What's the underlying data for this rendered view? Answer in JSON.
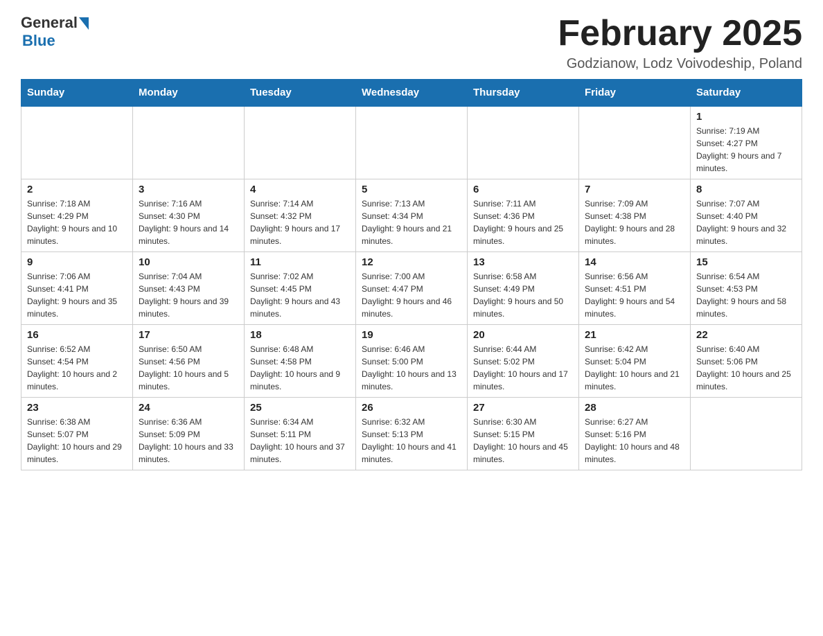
{
  "header": {
    "logo_general": "General",
    "logo_blue": "Blue",
    "month_title": "February 2025",
    "location": "Godzianow, Lodz Voivodeship, Poland"
  },
  "days_of_week": [
    "Sunday",
    "Monday",
    "Tuesday",
    "Wednesday",
    "Thursday",
    "Friday",
    "Saturday"
  ],
  "weeks": [
    {
      "days": [
        {
          "num": "",
          "info": ""
        },
        {
          "num": "",
          "info": ""
        },
        {
          "num": "",
          "info": ""
        },
        {
          "num": "",
          "info": ""
        },
        {
          "num": "",
          "info": ""
        },
        {
          "num": "",
          "info": ""
        },
        {
          "num": "1",
          "info": "Sunrise: 7:19 AM\nSunset: 4:27 PM\nDaylight: 9 hours and 7 minutes."
        }
      ]
    },
    {
      "days": [
        {
          "num": "2",
          "info": "Sunrise: 7:18 AM\nSunset: 4:29 PM\nDaylight: 9 hours and 10 minutes."
        },
        {
          "num": "3",
          "info": "Sunrise: 7:16 AM\nSunset: 4:30 PM\nDaylight: 9 hours and 14 minutes."
        },
        {
          "num": "4",
          "info": "Sunrise: 7:14 AM\nSunset: 4:32 PM\nDaylight: 9 hours and 17 minutes."
        },
        {
          "num": "5",
          "info": "Sunrise: 7:13 AM\nSunset: 4:34 PM\nDaylight: 9 hours and 21 minutes."
        },
        {
          "num": "6",
          "info": "Sunrise: 7:11 AM\nSunset: 4:36 PM\nDaylight: 9 hours and 25 minutes."
        },
        {
          "num": "7",
          "info": "Sunrise: 7:09 AM\nSunset: 4:38 PM\nDaylight: 9 hours and 28 minutes."
        },
        {
          "num": "8",
          "info": "Sunrise: 7:07 AM\nSunset: 4:40 PM\nDaylight: 9 hours and 32 minutes."
        }
      ]
    },
    {
      "days": [
        {
          "num": "9",
          "info": "Sunrise: 7:06 AM\nSunset: 4:41 PM\nDaylight: 9 hours and 35 minutes."
        },
        {
          "num": "10",
          "info": "Sunrise: 7:04 AM\nSunset: 4:43 PM\nDaylight: 9 hours and 39 minutes."
        },
        {
          "num": "11",
          "info": "Sunrise: 7:02 AM\nSunset: 4:45 PM\nDaylight: 9 hours and 43 minutes."
        },
        {
          "num": "12",
          "info": "Sunrise: 7:00 AM\nSunset: 4:47 PM\nDaylight: 9 hours and 46 minutes."
        },
        {
          "num": "13",
          "info": "Sunrise: 6:58 AM\nSunset: 4:49 PM\nDaylight: 9 hours and 50 minutes."
        },
        {
          "num": "14",
          "info": "Sunrise: 6:56 AM\nSunset: 4:51 PM\nDaylight: 9 hours and 54 minutes."
        },
        {
          "num": "15",
          "info": "Sunrise: 6:54 AM\nSunset: 4:53 PM\nDaylight: 9 hours and 58 minutes."
        }
      ]
    },
    {
      "days": [
        {
          "num": "16",
          "info": "Sunrise: 6:52 AM\nSunset: 4:54 PM\nDaylight: 10 hours and 2 minutes."
        },
        {
          "num": "17",
          "info": "Sunrise: 6:50 AM\nSunset: 4:56 PM\nDaylight: 10 hours and 5 minutes."
        },
        {
          "num": "18",
          "info": "Sunrise: 6:48 AM\nSunset: 4:58 PM\nDaylight: 10 hours and 9 minutes."
        },
        {
          "num": "19",
          "info": "Sunrise: 6:46 AM\nSunset: 5:00 PM\nDaylight: 10 hours and 13 minutes."
        },
        {
          "num": "20",
          "info": "Sunrise: 6:44 AM\nSunset: 5:02 PM\nDaylight: 10 hours and 17 minutes."
        },
        {
          "num": "21",
          "info": "Sunrise: 6:42 AM\nSunset: 5:04 PM\nDaylight: 10 hours and 21 minutes."
        },
        {
          "num": "22",
          "info": "Sunrise: 6:40 AM\nSunset: 5:06 PM\nDaylight: 10 hours and 25 minutes."
        }
      ]
    },
    {
      "days": [
        {
          "num": "23",
          "info": "Sunrise: 6:38 AM\nSunset: 5:07 PM\nDaylight: 10 hours and 29 minutes."
        },
        {
          "num": "24",
          "info": "Sunrise: 6:36 AM\nSunset: 5:09 PM\nDaylight: 10 hours and 33 minutes."
        },
        {
          "num": "25",
          "info": "Sunrise: 6:34 AM\nSunset: 5:11 PM\nDaylight: 10 hours and 37 minutes."
        },
        {
          "num": "26",
          "info": "Sunrise: 6:32 AM\nSunset: 5:13 PM\nDaylight: 10 hours and 41 minutes."
        },
        {
          "num": "27",
          "info": "Sunrise: 6:30 AM\nSunset: 5:15 PM\nDaylight: 10 hours and 45 minutes."
        },
        {
          "num": "28",
          "info": "Sunrise: 6:27 AM\nSunset: 5:16 PM\nDaylight: 10 hours and 48 minutes."
        },
        {
          "num": "",
          "info": ""
        }
      ]
    }
  ]
}
